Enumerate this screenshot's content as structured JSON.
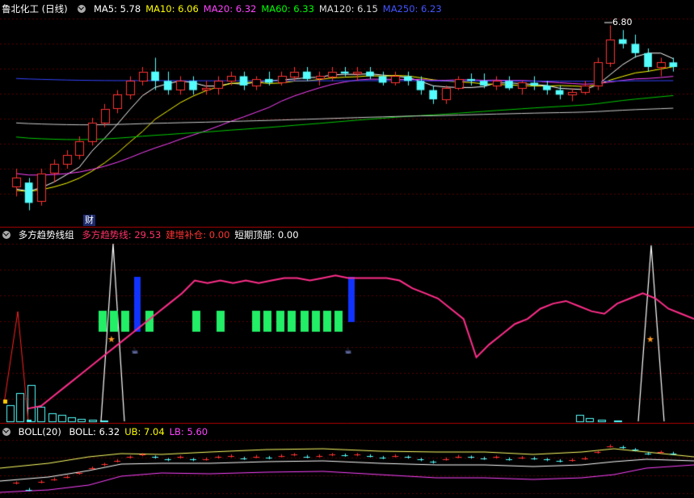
{
  "panel1": {
    "stock_title": "鲁北化工 (日线)",
    "ma": [
      {
        "label": "MA5",
        "value": "5.78",
        "color": "#ffffff"
      },
      {
        "label": "MA10",
        "value": "6.06",
        "color": "#ffff00"
      },
      {
        "label": "MA20",
        "value": "6.32",
        "color": "#ff44ff"
      },
      {
        "label": "MA60",
        "value": "6.33",
        "color": "#00ff00"
      },
      {
        "label": "MA120",
        "value": "6.15",
        "color": "#dddddd"
      },
      {
        "label": "MA250",
        "value": "6.23",
        "color": "#4455ff"
      }
    ],
    "peak_label": "6.80",
    "event_tag": "财"
  },
  "panel2": {
    "title": "多方趋势线组",
    "items": [
      {
        "label": "多方趋势线",
        "value": "29.53",
        "color": "#ff3366"
      },
      {
        "label": "建增补仓",
        "value": "0.00",
        "color": "#ff3333"
      },
      {
        "label": "短期顶部",
        "value": "0.00",
        "color": "#ffffff"
      }
    ]
  },
  "panel3": {
    "title": "BOLL(20)",
    "items": [
      {
        "label": "BOLL",
        "value": "6.32",
        "color": "#ffffff"
      },
      {
        "label": "UB",
        "value": "7.04",
        "color": "#ffff00"
      },
      {
        "label": "LB",
        "value": "5.60",
        "color": "#ff44ff"
      }
    ]
  },
  "chart_data": [
    {
      "type": "candlestick",
      "title": "鲁北化工 (日线)",
      "peak_annotation": 6.8,
      "ohlc": [
        [
          5.05,
          5.25,
          4.95,
          5.15
        ],
        [
          5.1,
          5.15,
          4.8,
          4.88
        ],
        [
          4.9,
          5.25,
          4.85,
          5.2
        ],
        [
          5.2,
          5.35,
          5.1,
          5.3
        ],
        [
          5.3,
          5.45,
          5.25,
          5.4
        ],
        [
          5.4,
          5.6,
          5.35,
          5.55
        ],
        [
          5.55,
          5.8,
          5.5,
          5.75
        ],
        [
          5.75,
          5.95,
          5.7,
          5.9
        ],
        [
          5.9,
          6.1,
          5.85,
          6.05
        ],
        [
          6.05,
          6.25,
          6.0,
          6.2
        ],
        [
          6.2,
          6.35,
          6.15,
          6.3
        ],
        [
          6.3,
          6.45,
          6.1,
          6.2
        ],
        [
          6.2,
          6.3,
          6.05,
          6.1
        ],
        [
          6.1,
          6.25,
          6.05,
          6.2
        ],
        [
          6.2,
          6.25,
          6.05,
          6.1
        ],
        [
          6.1,
          6.2,
          6.05,
          6.12
        ],
        [
          6.12,
          6.25,
          6.05,
          6.2
        ],
        [
          6.2,
          6.3,
          6.15,
          6.25
        ],
        [
          6.25,
          6.3,
          6.1,
          6.15
        ],
        [
          6.15,
          6.25,
          6.1,
          6.22
        ],
        [
          6.22,
          6.3,
          6.15,
          6.18
        ],
        [
          6.18,
          6.3,
          6.15,
          6.25
        ],
        [
          6.25,
          6.35,
          6.2,
          6.3
        ],
        [
          6.3,
          6.35,
          6.2,
          6.22
        ],
        [
          6.22,
          6.3,
          6.15,
          6.25
        ],
        [
          6.25,
          6.35,
          6.2,
          6.3
        ],
        [
          6.3,
          6.35,
          6.25,
          6.28
        ],
        [
          6.28,
          6.35,
          6.2,
          6.3
        ],
        [
          6.3,
          6.35,
          6.22,
          6.25
        ],
        [
          6.25,
          6.3,
          6.15,
          6.18
        ],
        [
          6.18,
          6.3,
          6.15,
          6.25
        ],
        [
          6.25,
          6.3,
          6.15,
          6.2
        ],
        [
          6.2,
          6.25,
          6.05,
          6.1
        ],
        [
          6.1,
          6.15,
          5.95,
          6.0
        ],
        [
          6.0,
          6.15,
          5.95,
          6.12
        ],
        [
          6.12,
          6.25,
          6.1,
          6.22
        ],
        [
          6.22,
          6.28,
          6.15,
          6.2
        ],
        [
          6.2,
          6.28,
          6.12,
          6.15
        ],
        [
          6.15,
          6.25,
          6.1,
          6.2
        ],
        [
          6.2,
          6.25,
          6.1,
          6.12
        ],
        [
          6.12,
          6.2,
          6.05,
          6.18
        ],
        [
          6.18,
          6.25,
          6.1,
          6.15
        ],
        [
          6.15,
          6.2,
          6.05,
          6.1
        ],
        [
          6.1,
          6.15,
          6.0,
          6.05
        ],
        [
          6.05,
          6.12,
          5.98,
          6.08
        ],
        [
          6.08,
          6.2,
          6.05,
          6.15
        ],
        [
          6.15,
          6.45,
          6.1,
          6.4
        ],
        [
          6.4,
          6.8,
          6.35,
          6.65
        ],
        [
          6.65,
          6.75,
          6.55,
          6.6
        ],
        [
          6.6,
          6.7,
          6.45,
          6.5
        ],
        [
          6.5,
          6.55,
          6.3,
          6.35
        ],
        [
          6.35,
          6.45,
          6.25,
          6.4
        ],
        [
          6.4,
          6.45,
          6.3,
          6.35
        ]
      ],
      "ma_series": [
        "MA5",
        "MA10",
        "MA20",
        "MA60",
        "MA120",
        "MA250"
      ]
    },
    {
      "type": "line+bar",
      "title": "多方趋势线组",
      "trend_line": [
        5,
        6,
        10,
        14,
        18,
        22,
        26,
        30,
        34,
        38,
        42,
        46,
        50,
        55,
        54,
        55,
        54,
        55,
        54,
        55,
        56,
        56,
        55,
        56,
        57,
        56,
        56,
        56,
        56,
        55,
        52,
        50,
        48,
        44,
        40,
        25,
        30,
        34,
        38,
        40,
        44,
        46,
        47,
        45,
        43,
        42,
        46,
        48,
        50,
        48,
        44,
        42,
        40
      ]
    },
    {
      "type": "line",
      "title": "BOLL(20)",
      "BOLL": 6.32,
      "UB": 7.04,
      "LB": 5.6
    }
  ]
}
